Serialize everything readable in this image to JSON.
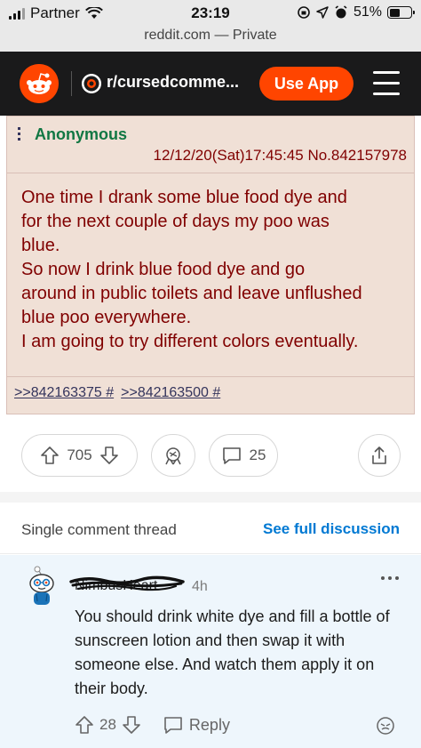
{
  "status_bar": {
    "carrier": "Partner",
    "time": "23:19",
    "battery": "51%",
    "battery_level": 0.51
  },
  "browser": {
    "url": "reddit.com — Private"
  },
  "header": {
    "subreddit": "r/cursedcomme...",
    "use_app_label": "Use App"
  },
  "post_image": {
    "name": "Anonymous",
    "meta": "12/12/20(Sat)17:45:45 No.842157978",
    "lines": [
      "One time I drank some blue food dye and",
      "for the next couple of days my poo was",
      "blue.",
      "So now I drink blue food dye and go",
      "around in public toilets and leave unflushed",
      "blue poo everywhere.",
      "I am going to try different colors eventually."
    ],
    "reply_links": [
      ">>842163375 #",
      ">>842163500 #"
    ]
  },
  "post_actions": {
    "vote_count": "705",
    "comment_count": "25"
  },
  "thread_bar": {
    "title": "Single comment thread",
    "see_full": "See full discussion"
  },
  "comment": {
    "author": "NimbusHeart",
    "time": "4h",
    "body": "You should drink white dye and fill a bottle of sunscreen lotion and then swap it with someone else. And watch them apply it on their body.",
    "vote_count": "28",
    "reply_label": "Reply"
  },
  "colors": {
    "reddit_orange": "#ff4500",
    "link_blue": "#0079d3",
    "chan_bg": "#f0e0d6",
    "chan_red": "#800000",
    "chan_green": "#117743",
    "comment_bg": "#eef6fc"
  }
}
